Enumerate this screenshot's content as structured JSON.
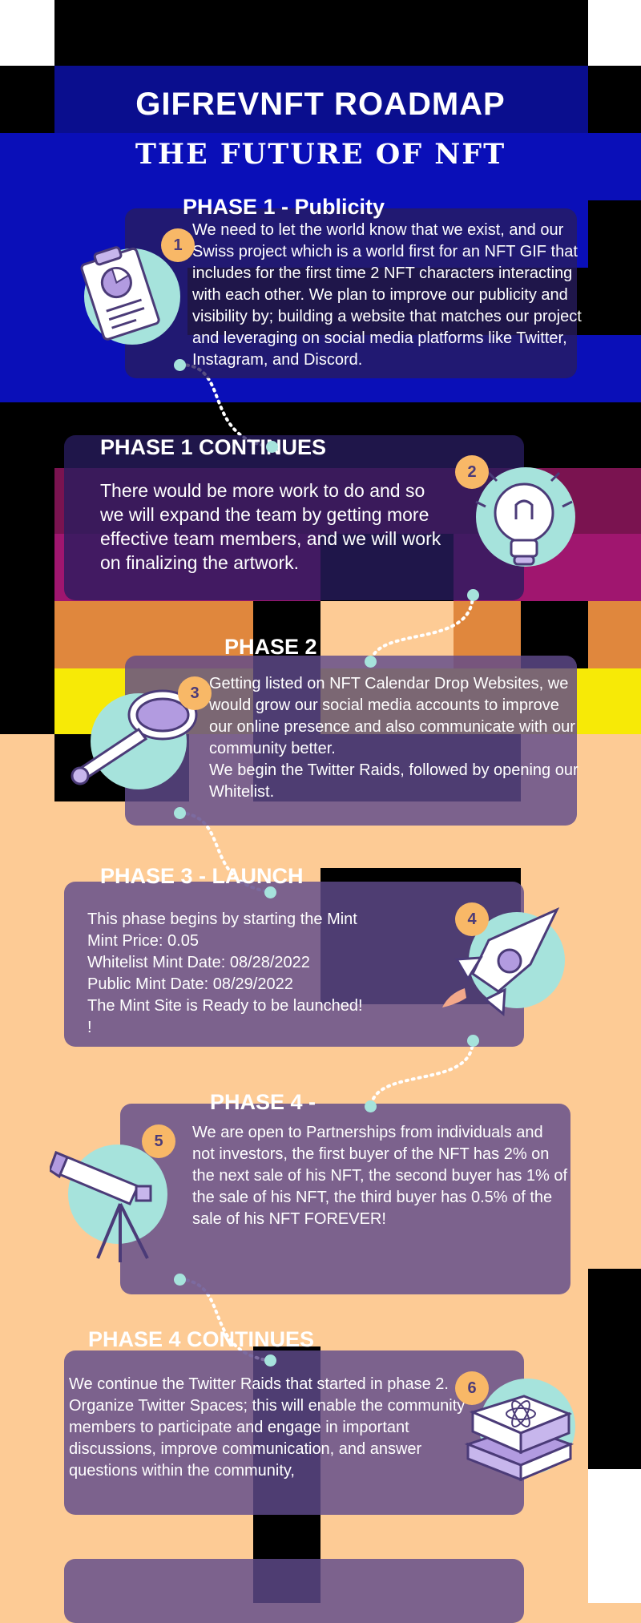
{
  "title": "GIFREVNFT ROADMAP",
  "subtitle": "THE FUTURE OF NFT",
  "phases": [
    {
      "number": "1",
      "title": "PHASE 1 - Publicity",
      "text": "We need to let the world know that we exist, and our Swiss project which is a world first for an NFT GIF that includes for the first time 2 NFT characters interacting with each other. We plan to improve our publicity and visibility by; building a website that matches our project and leveraging on social media platforms like Twitter, Instagram, and Discord.",
      "icon": "clipboard-chart-icon"
    },
    {
      "number": "2",
      "title": "PHASE 1 CONTINUES",
      "text": "There would be more work to do and so we will expand the team by getting more effective team members, and we will work on finalizing the artwork.",
      "icon": "lightbulb-icon"
    },
    {
      "number": "3",
      "title": "PHASE 2",
      "text": "Getting listed on NFT Calendar Drop Websites, we would grow our social media accounts to improve our online presence and also communicate with our community better.\nWe begin the Twitter Raids, followed by opening our Whitelist.",
      "icon": "magnifying-glass-icon"
    },
    {
      "number": "4",
      "title": "PHASE 3 - LAUNCH",
      "text": "This phase begins by starting the Mint\nMint Price: 0.05\nWhitelist Mint Date: 08/28/2022\nPublic Mint Date: 08/29/2022\nThe Mint Site is Ready to be launched!\n!",
      "icon": "rocket-icon"
    },
    {
      "number": "5",
      "title": "PHASE 4 -",
      "text": "We are open to Partnerships from individuals and not investors, the first buyer of the NFT has 2% on the next sale of his NFT, the second buyer has 1% of the sale of his NFT, the third buyer has 0.5% of the sale of his NFT FOREVER!",
      "icon": "telescope-icon"
    },
    {
      "number": "6",
      "title": "PHASE 4 CONTINUES",
      "text": "We continue the Twitter Raids that started in phase 2.\nOrganize Twitter Spaces; this will enable the community members to participate and engage in important discussions, improve communication, and answer questions within the community,",
      "icon": "science-books-icon"
    }
  ],
  "colors": {
    "peach": "#fdcb95",
    "blue": "#0a0fb8",
    "magenta": "#8e1360",
    "orange": "#e0873d",
    "yellow": "#f7ea06",
    "card": "#5f4a8b",
    "badge": "#f8b867",
    "teal": "#a6e3dc"
  }
}
